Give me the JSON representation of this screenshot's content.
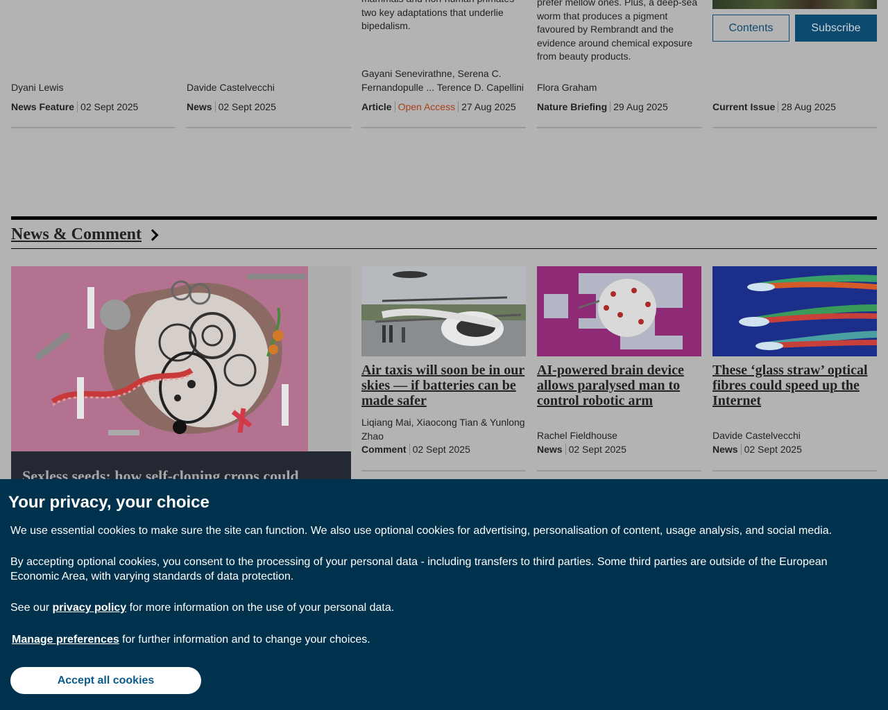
{
  "top_cards": [
    {
      "snippet": [],
      "authors": [
        "Dyani Lewis"
      ],
      "type": "News Feature",
      "open_access": "",
      "date": "02 Sept 2025"
    },
    {
      "snippet": [],
      "authors": [
        "Davide Castelvecchi"
      ],
      "type": "News",
      "open_access": "",
      "date": "02 Sept 2025"
    },
    {
      "snippet": [
        "mammals and non-human primates",
        "two key adaptations that underlie",
        "bipedalism."
      ],
      "authors": [
        "Gayani Senevirathne, Serena C.",
        "Fernandopulle ... Terence D. Capellini"
      ],
      "type": "Article",
      "open_access": "Open Access",
      "date": "27 Aug 2025"
    },
    {
      "snippet": [
        "prefer mellow ones. Plus, a deep-sea",
        "worm that produces a pigment",
        "favoured by Rembrandt and the",
        "evidence around chemical exposure",
        "from beauty products."
      ],
      "authors": [
        "Flora Graham"
      ],
      "type": "Nature Briefing",
      "open_access": "",
      "date": "29 Aug 2025"
    },
    {
      "snippet": [],
      "authors": [],
      "type": "Current Issue",
      "open_access": "",
      "date": "28 Aug 2025"
    }
  ],
  "issue_buttons": {
    "contents": "Contents",
    "subscribe": "Subscribe"
  },
  "section": {
    "title": "News & Comment"
  },
  "feature": {
    "title": "Sexless seeds: how self-cloning crops could"
  },
  "news_cards": [
    {
      "title": [
        "Air taxis will soon be in our",
        "skies — if batteries can be",
        "made safer"
      ],
      "authors": [
        "Liqiang Mai, Xiaocong Tian & Yunlong",
        "Zhao"
      ],
      "type": "Comment",
      "date": "02 Sept 2025"
    },
    {
      "title": [
        "AI-powered brain device",
        "allows paralysed man to",
        "control robotic arm"
      ],
      "authors": [
        "Rachel Fieldhouse"
      ],
      "type": "News",
      "date": "02 Sept 2025"
    },
    {
      "title": [
        "These ‘glass straw’ optical",
        "fibres could speed up the",
        "Internet"
      ],
      "authors": [
        "Davide Castelvecchi"
      ],
      "type": "News",
      "date": "02 Sept 2025"
    }
  ],
  "cookie": {
    "heading": "Your privacy, your choice",
    "p1": "We use essential cookies to make sure the site can function. We also use optional cookies for advertising, personalisation of content, usage analysis, and social media.",
    "p2": "By accepting optional cookies, you consent to the processing of your personal data - including transfers to third parties. Some third parties are outside of the European Economic Area, with varying standards of data protection.",
    "p3_before": "See our ",
    "privacy_link": "privacy policy",
    "p3_after": " for more information on the use of your personal data.",
    "manage_link": "Manage preferences",
    "p4_after": " for further information and to change your choices.",
    "accept": "Accept all cookies"
  }
}
